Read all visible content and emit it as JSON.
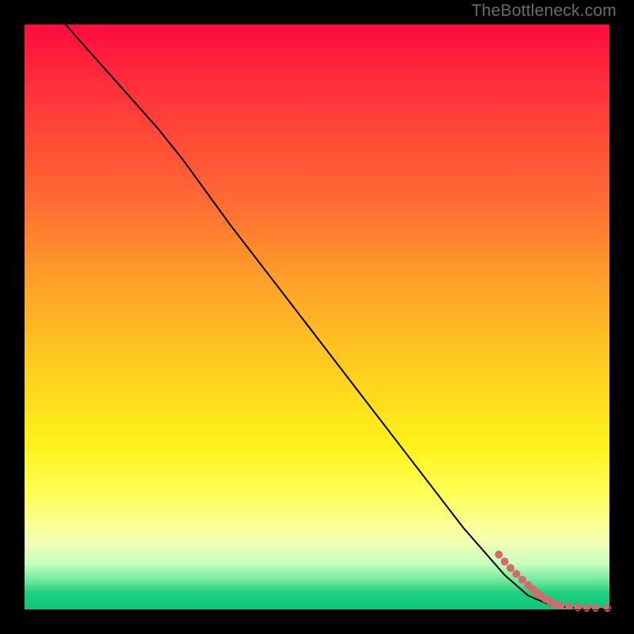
{
  "watermark": "TheBottleneck.com",
  "chart_data": {
    "type": "line",
    "title": "",
    "xlabel": "",
    "ylabel": "",
    "xlim": [
      0,
      100
    ],
    "ylim": [
      0,
      100
    ],
    "series": [
      {
        "name": "black-curve",
        "style": "line",
        "color": "#000000",
        "x": [
          7,
          15,
          23,
          27,
          35,
          45,
          55,
          65,
          75,
          82,
          86,
          90,
          95,
          100
        ],
        "y": [
          100,
          91,
          82,
          77,
          66,
          53,
          40,
          27,
          14,
          6,
          2.5,
          0.8,
          0.3,
          0.2
        ]
      },
      {
        "name": "red-dots",
        "style": "scatter",
        "color": "#d46a6a",
        "x": [
          81,
          82,
          83,
          84,
          85,
          86,
          86.8,
          87.5,
          88.2,
          89,
          89.7,
          90.4,
          91.5,
          93,
          94.5,
          96,
          97.5,
          99.5
        ],
        "y": [
          9.5,
          8.3,
          7.2,
          6.2,
          5.2,
          4.3,
          3.6,
          3.0,
          2.4,
          1.9,
          1.5,
          1.1,
          0.8,
          0.6,
          0.5,
          0.45,
          0.42,
          0.4
        ]
      }
    ],
    "background_gradient": {
      "direction": "vertical",
      "stops": [
        {
          "pos": 0.0,
          "color": "#ff0b3e"
        },
        {
          "pos": 0.3,
          "color": "#ff6a33"
        },
        {
          "pos": 0.6,
          "color": "#ffd11f"
        },
        {
          "pos": 0.8,
          "color": "#ffff55"
        },
        {
          "pos": 0.92,
          "color": "#c8ffc0"
        },
        {
          "pos": 1.0,
          "color": "#08c77a"
        }
      ]
    }
  }
}
